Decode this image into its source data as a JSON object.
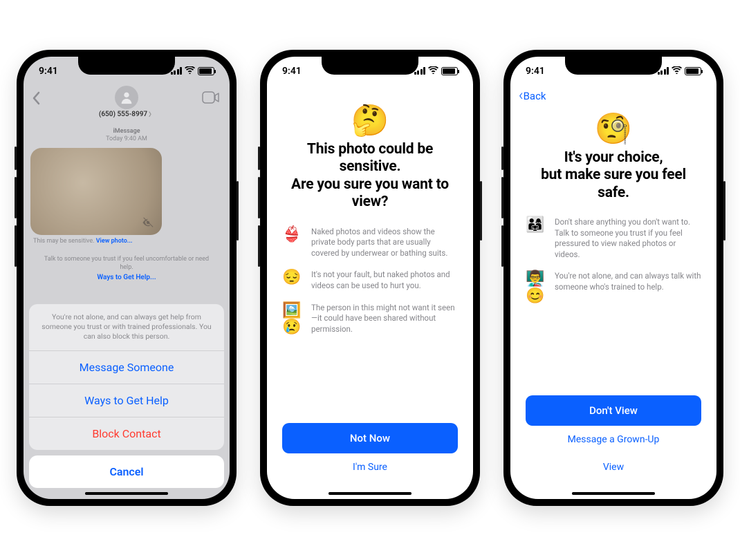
{
  "status": {
    "time": "9:41"
  },
  "phone1": {
    "contact_number": "(650) 555-8997",
    "service": "iMessage",
    "timestamp": "Today 9:40 AM",
    "caption_prefix": "This may be sensitive.",
    "caption_link": "View photo...",
    "help_line": "Talk to someone you trust if you feel uncomfortable or need help.",
    "help_link": "Ways to Get Help...",
    "sheet_message": "You're not alone, and can always get help from someone you trust or with trained professionals. You can also block this person.",
    "btn_message": "Message Someone",
    "btn_ways": "Ways to Get Help",
    "btn_block": "Block Contact",
    "btn_cancel": "Cancel"
  },
  "phone2": {
    "emoji": "🤔",
    "headline": "This photo could be sensitive.\nAre you sure you want to view?",
    "bullets": [
      {
        "emoji": "👙",
        "text": "Naked photos and videos show the private body parts that are usually covered by underwear or bathing suits."
      },
      {
        "emoji": "😔",
        "text": "It's not your fault, but naked photos and videos can be used to hurt you."
      },
      {
        "emoji": "🖼️😢",
        "text": "The person in this might not want it seen—it could have been shared without permission."
      }
    ],
    "primary": "Not Now",
    "secondary": "I'm Sure"
  },
  "phone3": {
    "back_label": "Back",
    "emoji": "🧐",
    "headline": "It's your choice,\nbut make sure you feel safe.",
    "bullets": [
      {
        "emoji": "👨‍👩‍👧",
        "text": "Don't share anything you don't want to. Talk to someone you trust if you feel pressured to view naked photos or videos."
      },
      {
        "emoji": "👨‍🏫😊",
        "text": "You're not alone, and can always talk with someone who's trained to help."
      }
    ],
    "primary": "Don't View",
    "secondary1": "Message a Grown-Up",
    "secondary2": "View"
  }
}
